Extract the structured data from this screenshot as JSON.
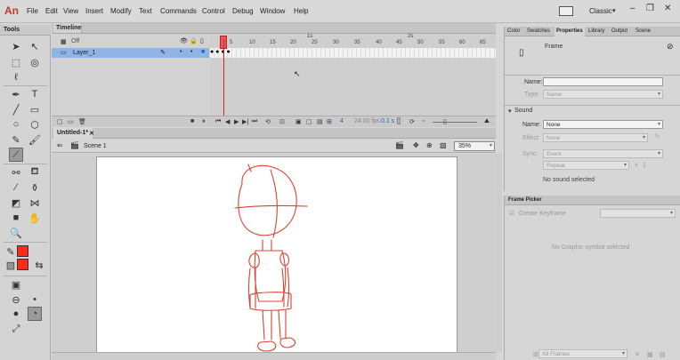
{
  "app": {
    "logo": "An"
  },
  "menu": [
    "File",
    "Edit",
    "View",
    "Insert",
    "Modify",
    "Text",
    "Commands",
    "Control",
    "Debug",
    "Window",
    "Help"
  ],
  "workspace": {
    "label": "Classic"
  },
  "tools": {
    "title": "Tools"
  },
  "timeline": {
    "tab": "Timeline",
    "rows": [
      {
        "name": "Off"
      },
      {
        "name": "Layer_1"
      }
    ],
    "ruler": [
      "5",
      "10",
      "15",
      "20",
      "25",
      "30",
      "35",
      "40",
      "45",
      "50",
      "55",
      "60",
      "65"
    ],
    "seconds": [
      "1s",
      "2s"
    ],
    "current_frame": "4",
    "fps": "24.00 fps",
    "time": "0.1 s"
  },
  "document": {
    "tab": "Untitled-1*",
    "scene": "Scene 1",
    "zoom": "35%"
  },
  "properties": {
    "tabs": [
      "Color",
      "Swatches",
      "Properties",
      "Library",
      "Output",
      "Scene"
    ],
    "active_tab": "Properties",
    "type_label": "Frame",
    "name_label": "Name:",
    "name_value": "",
    "type_field_label": "Type:",
    "type_value": "Name",
    "sound_section": "Sound",
    "sound_name_label": "Name:",
    "sound_name_value": "None",
    "effect_label": "Effect:",
    "effect_value": "None",
    "sync_label": "Sync:",
    "sync_value": "Event",
    "repeat_value": "Repeat",
    "repeat_count": "1",
    "no_sound": "No sound selected"
  },
  "frame_picker": {
    "tab": "Frame Picker",
    "create_keyframe": "Create Keyframe",
    "empty_msg": "No Graphic symbol selected",
    "all_frames": "All Frames"
  },
  "colors": {
    "stroke": "#ff2a1a",
    "fill": "#ff2a1a",
    "sketch": "#d9442f",
    "layer_highlight": "#8fb4e6"
  }
}
